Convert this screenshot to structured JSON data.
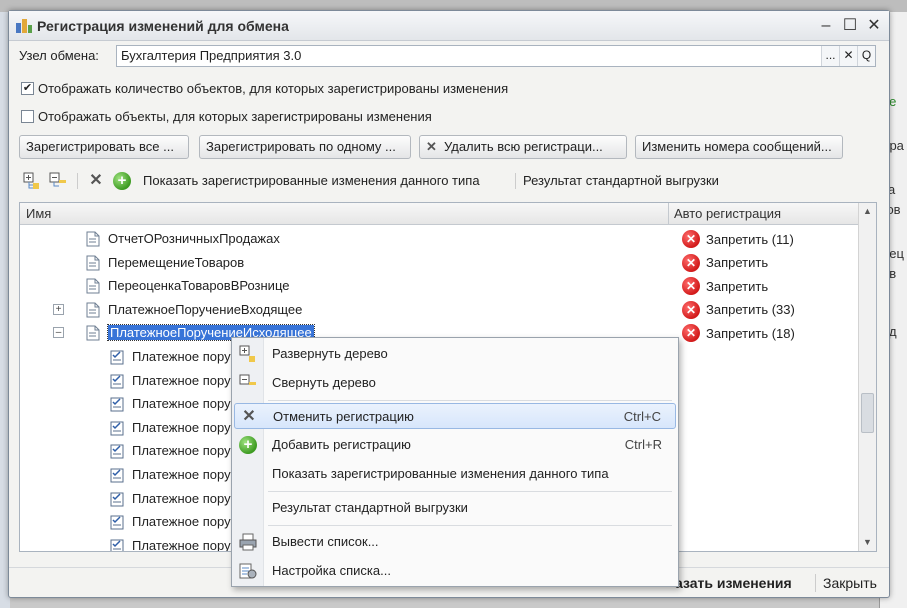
{
  "window": {
    "title": "Регистрация изменений для обмена",
    "minimize": "–",
    "maximize": "☐",
    "close": "✕"
  },
  "node": {
    "label": "Узел обмена:",
    "value": "Бухгалтерия Предприятия 3.0",
    "select_btn": "...",
    "clear_btn": "✕",
    "open_btn": "Q"
  },
  "options": {
    "show_count_label": "Отображать количество объектов, для которых зарегистрированы изменения",
    "show_count_checked": true,
    "show_objects_label": "Отображать объекты, для которых зарегистрированы изменения",
    "show_objects_checked": false
  },
  "buttons": {
    "register_all": "Зарегистрировать все ...",
    "register_one": "Зарегистрировать по одному ...",
    "delete_all": "Удалить всю регистраци...",
    "change_numbers": "Изменить номера сообщений..."
  },
  "toolbar": {
    "show_registered": "Показать зарегистрированные изменения данного типа",
    "standard_export": "Результат стандартной выгрузки"
  },
  "grid": {
    "col_name": "Имя",
    "col_auto": "Авто регистрация",
    "rows": [
      {
        "name": "ОтчетОРозничныхПродажах",
        "status": "Запретить (11)"
      },
      {
        "name": "ПеремещениеТоваров",
        "status": "Запретить"
      },
      {
        "name": "ПереоценкаТоваровВРознице",
        "status": "Запретить"
      },
      {
        "name": "ПлатежноеПоручениеВходящее",
        "status": "Запретить (33)",
        "expander": "+"
      },
      {
        "name": "ПлатежноеПоручениеИсходящее",
        "status": "Запретить (18)",
        "expander": "–"
      }
    ],
    "child_rows": [
      "Платежное пору",
      "Платежное пору",
      "Платежное пору",
      "Платежное пору",
      "Платежное пору",
      "Платежное пору",
      "Платежное пору",
      "Платежное пору",
      "Платежное пору"
    ]
  },
  "footer": {
    "show_changes": "азать изменения",
    "close": "Закрыть"
  },
  "context_menu": {
    "expand": "Развернуть дерево",
    "collapse": "Свернуть дерево",
    "cancel_reg": "Отменить регистрацию",
    "cancel_reg_shortcut": "Ctrl+C",
    "add_reg": "Добавить регистрацию",
    "add_reg_shortcut": "Ctrl+R",
    "show_registered": "Показать зарегистрированные изменения данного типа",
    "standard_export": "Результат стандартной выгрузки",
    "output_list": "Вывести список...",
    "list_settings": "Настройка списка..."
  },
  "background": {
    "frag1": "не",
    "frag2": "бра",
    "frag3": "за",
    "frag4": "гов",
    "frag5": "иец",
    "frag6": "ов",
    "frag7": "од"
  },
  "colors": {
    "selection": "#3874d8",
    "deny_red": "#d21a1a",
    "add_green": "#3c9a21"
  }
}
